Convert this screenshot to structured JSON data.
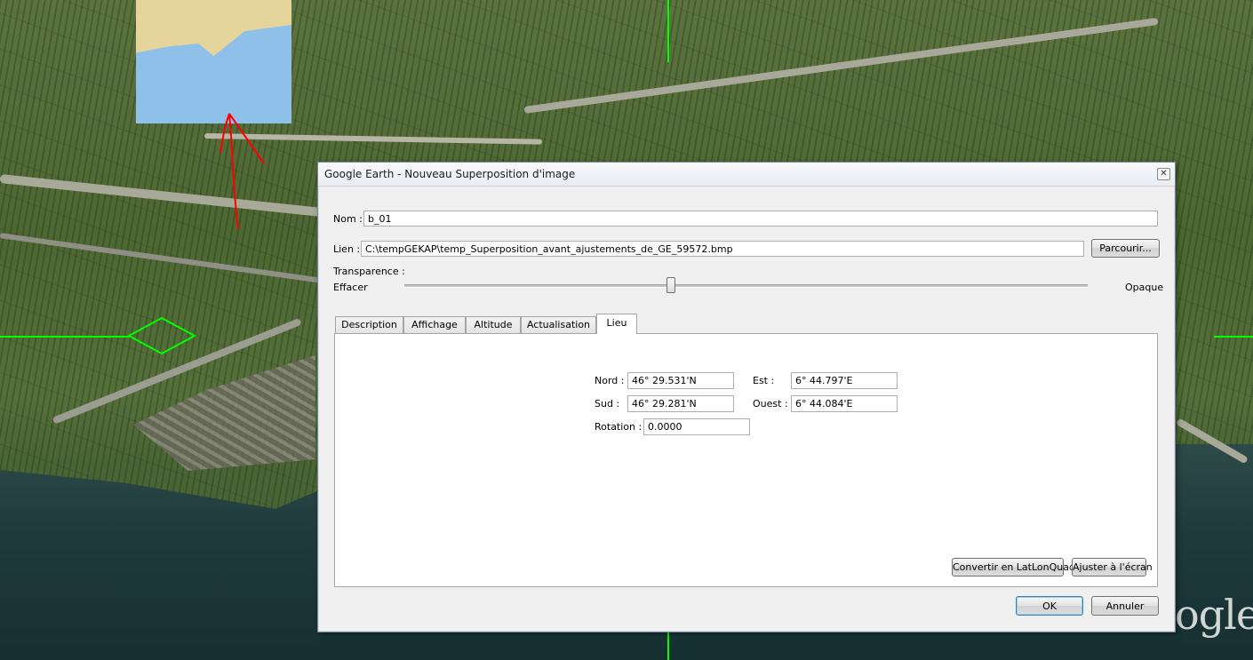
{
  "window": {
    "title": "Google Earth - Nouveau Superposition d'image",
    "close_glyph": "✕"
  },
  "form": {
    "name_label": "Nom :",
    "name_value": "b_01",
    "link_label": "Lien :",
    "link_value": "C:\\tempGEKAP\\temp_Superposition_avant_ajustements_de_GE_59572.bmp",
    "browse_label": "Parcourir..."
  },
  "transparency": {
    "label": "Transparence :",
    "min_label": "Effacer",
    "max_label": "Opaque",
    "value": 0.39
  },
  "tabs": [
    {
      "label": "Description",
      "active": false
    },
    {
      "label": "Affichage",
      "active": false
    },
    {
      "label": "Altitude",
      "active": false
    },
    {
      "label": "Actualisation",
      "active": false
    },
    {
      "label": "Lieu",
      "active": true
    }
  ],
  "location": {
    "north_label": "Nord :",
    "north_value": "46° 29.531'N",
    "south_label": "Sud :",
    "south_value": "46° 29.281'N",
    "east_label": "Est :",
    "east_value": "6° 44.797'E",
    "west_label": "Ouest :",
    "west_value": "6° 44.084'E",
    "rotation_label": "Rotation :",
    "rotation_value": "0.0000",
    "convert_button": "Convertir en LatLonQuad",
    "fit_button": "Ajuster à l'écran"
  },
  "footer": {
    "ok_label": "OK",
    "cancel_label": "Annuler"
  },
  "background": {
    "watermark": "ogle",
    "overlay_color": "#8ec0ea",
    "crosshair_color": "#00ff00",
    "annotation_color": "#ff0000"
  }
}
